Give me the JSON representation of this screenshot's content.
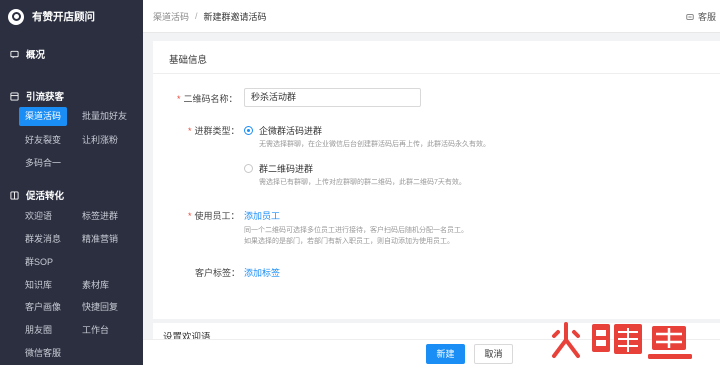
{
  "sidebar": {
    "brand": "有赞开店顾问",
    "overview": "概况",
    "growth": {
      "title": "引流获客",
      "items": [
        "渠道活码",
        "批量加好友",
        "好友裂变",
        "让利涨粉",
        "多码合一"
      ]
    },
    "convert": {
      "title": "促活转化",
      "items": [
        "欢迎语",
        "标签进群",
        "群发消息",
        "精准营销",
        "群SOP",
        "知识库",
        "素材库",
        "客户画像",
        "快捷回复",
        "朋友圈",
        "工作台",
        "微信客服"
      ]
    }
  },
  "breadcrumb": {
    "parent": "渠道活码",
    "current": "新建群邀请活码"
  },
  "topbar": {
    "service": "客服"
  },
  "form": {
    "section_title": "基础信息",
    "qr_name_label": "二维码名称：",
    "qr_name_value": "秒杀活动群",
    "join_type_label": "进群类型：",
    "option1_label": "企微群活码进群",
    "option1_hint": "无需选择群聊，在企业微信后台创建群活码后再上传，此群活码永久有效。",
    "option2_label": "群二维码进群",
    "option2_hint": "需选择已有群聊，上传对应群聊的群二维码，此群二维码7天有效。",
    "staff_label": "使用员工：",
    "add_staff": "添加员工",
    "staff_hint_1": "同一个二维码可选择多位员工进行接待，客户扫码后随机分配一名员工。",
    "staff_hint_2": "如果选择的是部门，若部门有新入职员工，则自动添加为使用员工。",
    "tag_label": "客户标签：",
    "add_tag": "添加标签"
  },
  "section2": {
    "title": "设置欢迎语"
  },
  "buttons": {
    "create": "新建",
    "cancel": "取消"
  },
  "watermark": {
    "text": "火鲤鱼"
  },
  "colors": {
    "accent": "#1b8ef5",
    "sidebar": "#2b2f3f",
    "required": "#e74c3c",
    "watermark": "#e8413a"
  }
}
